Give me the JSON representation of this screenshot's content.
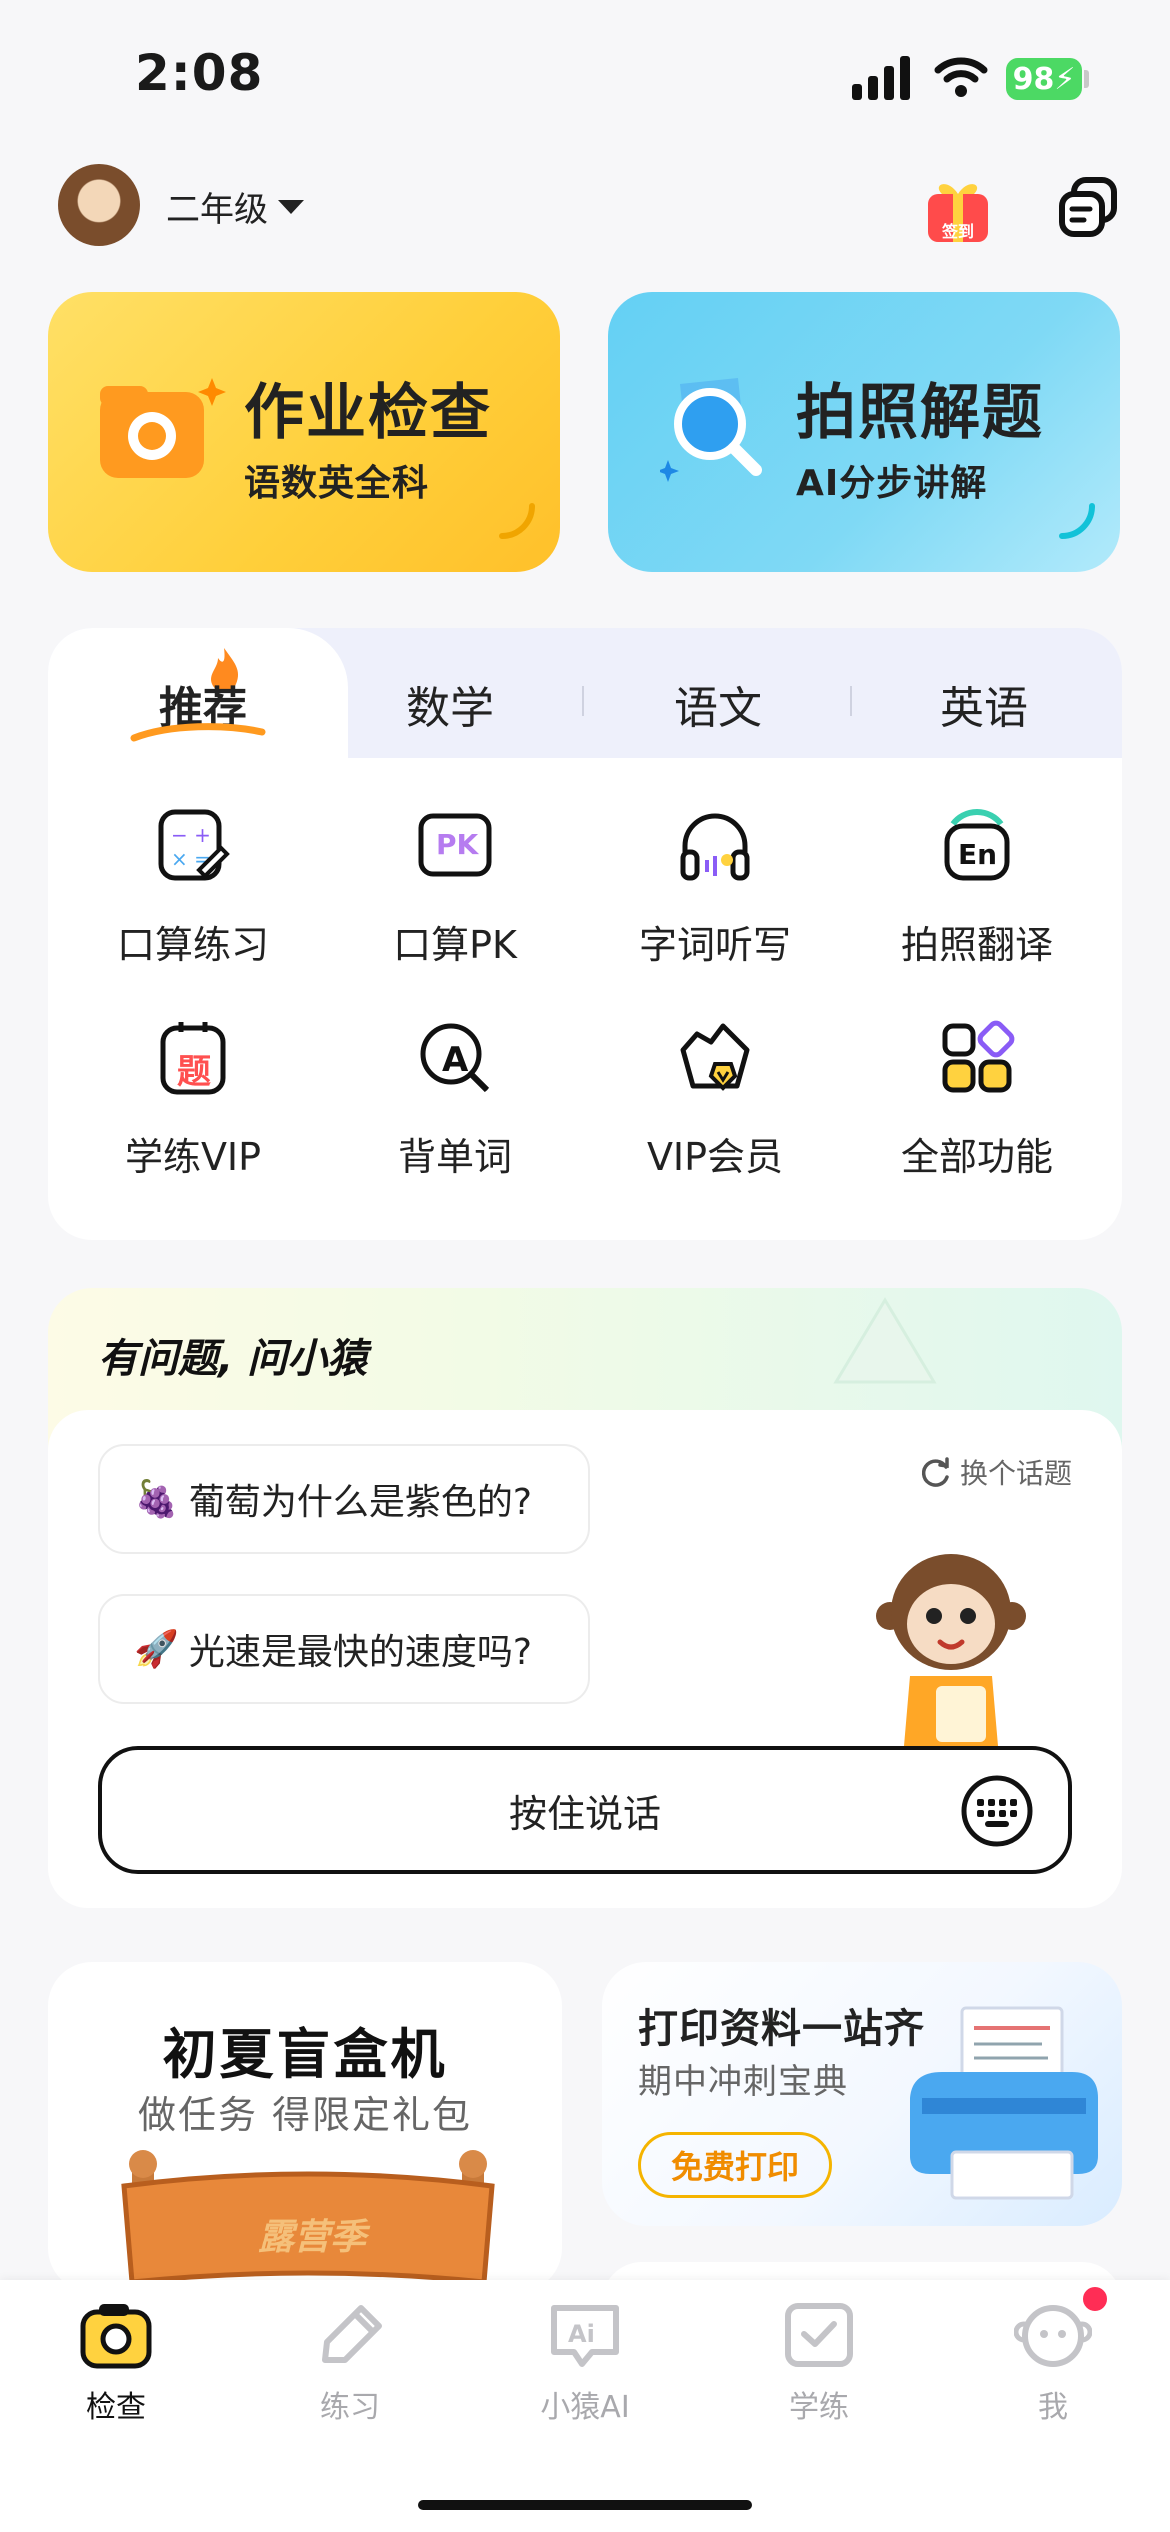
{
  "status_bar": {
    "time": "2:08",
    "battery": "98"
  },
  "header": {
    "grade_label": "二年级",
    "signin_badge": "签到"
  },
  "hero_cards": [
    {
      "title": "作业检查",
      "subtitle": "语数英全科"
    },
    {
      "title": "拍照解题",
      "subtitle": "AI分步讲解"
    }
  ],
  "subject_tabs": [
    {
      "label": "推荐",
      "active": true
    },
    {
      "label": "数学",
      "active": false
    },
    {
      "label": "语文",
      "active": false
    },
    {
      "label": "英语",
      "active": false
    }
  ],
  "features": [
    {
      "label": "口算练习",
      "icon": "calc-practice-icon"
    },
    {
      "label": "口算PK",
      "icon": "pk-icon",
      "icon_text": "PK"
    },
    {
      "label": "字词听写",
      "icon": "headphones-icon"
    },
    {
      "label": "拍照翻译",
      "icon": "translate-icon",
      "icon_text": "En"
    },
    {
      "label": "学练VIP",
      "icon": "question-book-icon",
      "icon_text": "题"
    },
    {
      "label": "背单词",
      "icon": "word-search-icon",
      "icon_text": "A"
    },
    {
      "label": "VIP会员",
      "icon": "vip-crown-icon"
    },
    {
      "label": "全部功能",
      "icon": "all-functions-icon"
    }
  ],
  "ask": {
    "title": "有问题, 问小猿",
    "switch_topic": "换个话题",
    "questions": [
      {
        "emoji": "🍇",
        "text": "葡萄为什么是紫色的?"
      },
      {
        "emoji": "🚀",
        "text": "光速是最快的速度吗?"
      }
    ],
    "speak_button": "按住说话"
  },
  "promos": {
    "left": {
      "title": "初夏盲盒机",
      "subtitle": "做任务 得限定礼包",
      "sign_text": "露营季"
    },
    "right": {
      "title": "打印资料一站齐",
      "subtitle": "期中冲刺宝典",
      "button": "免费打印"
    }
  },
  "tab_bar": [
    {
      "label": "检查",
      "icon": "camera-icon",
      "active": true
    },
    {
      "label": "练习",
      "icon": "pencil-icon",
      "active": false
    },
    {
      "label": "小猿AI",
      "icon": "ai-chat-icon",
      "active": false
    },
    {
      "label": "学练",
      "icon": "book-check-icon",
      "active": false
    },
    {
      "label": "我",
      "icon": "profile-icon",
      "active": false,
      "badge": true
    }
  ],
  "colors": {
    "accent_yellow": "#ffcf3a",
    "accent_blue": "#64d0f4",
    "promo_orange": "#f08c00",
    "badge_red": "#ff2d55"
  }
}
